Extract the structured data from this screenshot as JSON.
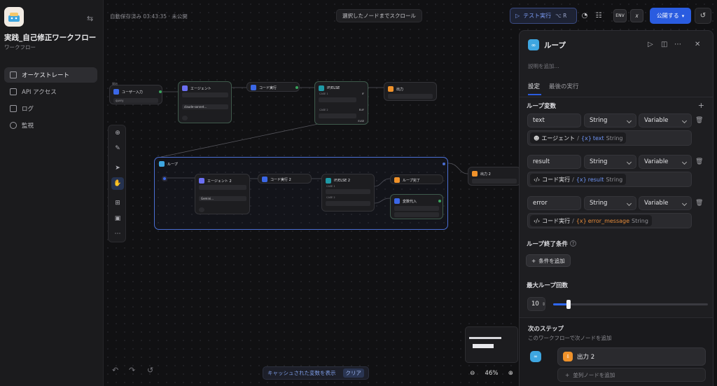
{
  "sidebar": {
    "app_name": "実践_自己修正ワークフロー",
    "app_type": "ワークフロー",
    "nav": [
      {
        "label": "オーケストレート",
        "active": true
      },
      {
        "label": "API アクセス",
        "active": false
      },
      {
        "label": "ログ",
        "active": false
      },
      {
        "label": "監視",
        "active": false
      }
    ]
  },
  "topbar": {
    "status": "自動保存済み 03:43:35 · 未公開",
    "scroll_to_selected": "選択したノードまでスクロール",
    "test_run": "テスト実行",
    "test_run_shortcut": "⌥ R",
    "env_label": "ENV",
    "publish": "公開する"
  },
  "nodes": {
    "start": {
      "label": "ユーザー入力",
      "badge": "開始",
      "var": "query"
    },
    "agent": {
      "label": "エージェント",
      "model": "claude-sonnet..."
    },
    "code": {
      "label": "コード実行"
    },
    "ifelse": {
      "label": "IF/ELSE",
      "case1": "CASE 1",
      "case2": "CASE 2",
      "if": "IF",
      "elif": "ELIF",
      "else": "ELSE"
    },
    "output": {
      "label": "出力"
    },
    "loop": {
      "label": "ループ"
    },
    "agent2": {
      "label": "エージェント 2",
      "model": "Gemini..."
    },
    "code2": {
      "label": "コード実行 2"
    },
    "ifelse2": {
      "label": "IF/ELSE 2",
      "case1": "CASE 1",
      "case2": "CASE 2"
    },
    "loop_end": {
      "label": "ループ完了"
    },
    "assign": {
      "label": "変数代入"
    },
    "output2": {
      "label": "出力 2"
    }
  },
  "panel": {
    "title": "ループ",
    "desc_placeholder": "説明を追加...",
    "tabs": [
      "設定",
      "最後の実行"
    ],
    "loop_vars_label": "ループ変数",
    "vars": [
      {
        "name": "text",
        "type": "String",
        "mode": "Variable",
        "src_node": "エージェント",
        "src_var": "text",
        "src_type": "String",
        "icon": "agent"
      },
      {
        "name": "result",
        "type": "String",
        "mode": "Variable",
        "src_node": "コード実行",
        "src_var": "result",
        "src_type": "String",
        "icon": "code"
      },
      {
        "name": "error",
        "type": "String",
        "mode": "Variable",
        "src_node": "コード実行",
        "src_var": "error_message",
        "src_type": "String",
        "icon": "code"
      }
    ],
    "var_prefix": "{x}",
    "exit_cond_label": "ループ終了条件",
    "add_cond": "条件を追加",
    "max_loop_label": "最大ループ回数",
    "max_loop_value": "10",
    "max_loop_fraction": 0.1,
    "next_step_label": "次のステップ",
    "next_step_desc": "このワークフローで次ノードを追加",
    "next_node": "出力 2",
    "parallel_add": "並列ノードを追加"
  },
  "bottom": {
    "cache_label": "キャッシュされた変数を表示",
    "clear": "クリア",
    "zoom": "46%"
  },
  "colors": {
    "accent": "#2a5ce0",
    "loop": "#3ea6e0",
    "output": "#f0922a",
    "agent": "#6b6ff2",
    "code": "#3b67e6",
    "ifelse": "#1e9aa6",
    "assign": "#3b67e6"
  }
}
